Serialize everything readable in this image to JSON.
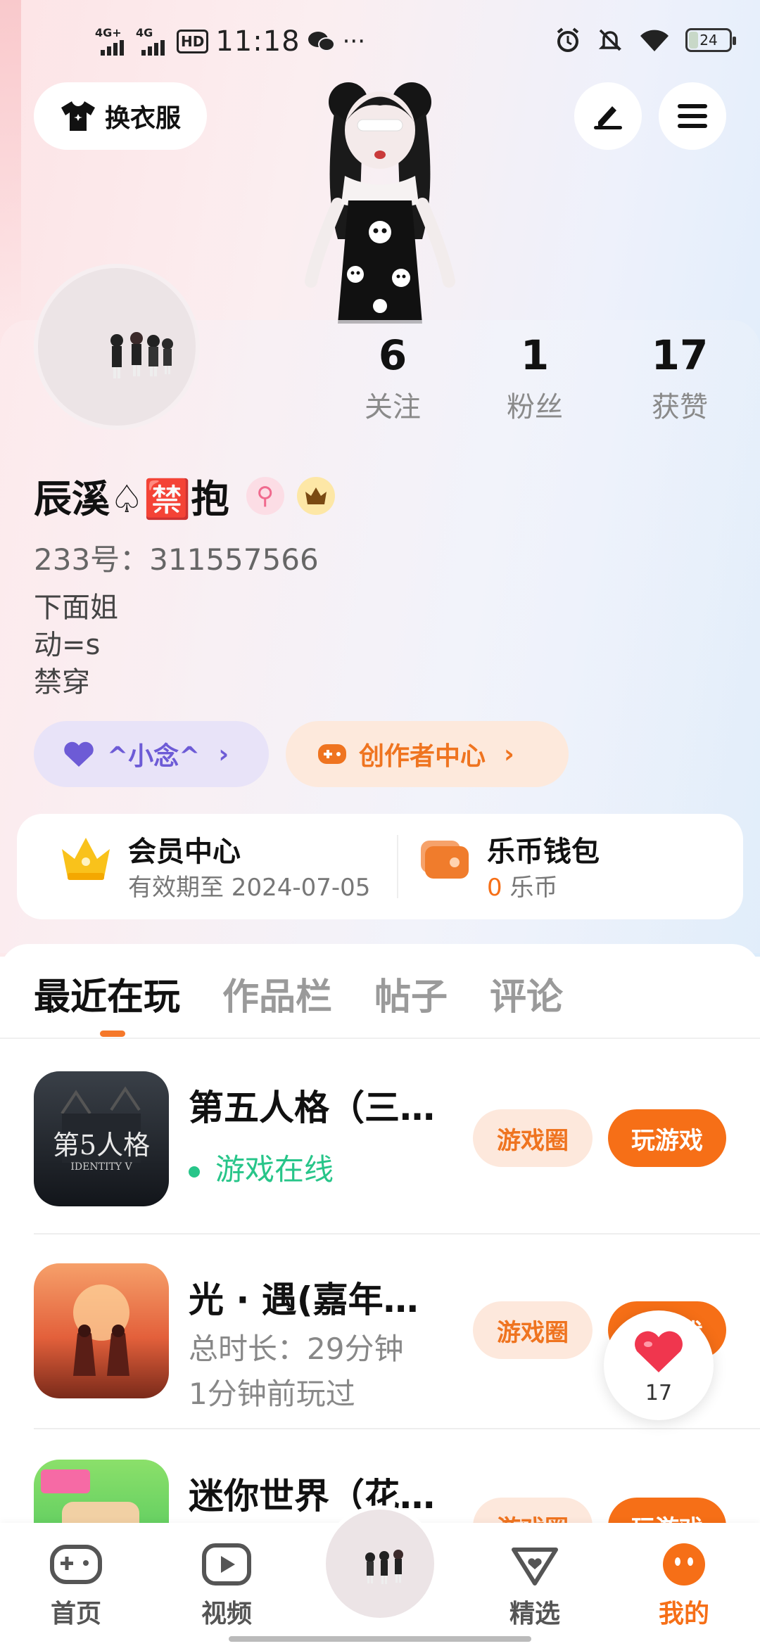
{
  "status_bar": {
    "net1": "4G+",
    "net2": "4G",
    "hd": "HD",
    "time": "11:18",
    "more": "···",
    "battery": "24"
  },
  "header": {
    "outfit_label": "换衣服"
  },
  "profile": {
    "stats": [
      {
        "value": "6",
        "label": "关注"
      },
      {
        "value": "1",
        "label": "粉丝"
      },
      {
        "value": "17",
        "label": "获赞"
      }
    ],
    "username": "辰溪♤🈲抱",
    "uid": "233号：311557566",
    "bio": [
      "下面姐",
      "动=s",
      "禁穿"
    ],
    "friend_pill": "^小念^",
    "creator_pill": "创作者中心"
  },
  "member": {
    "title": "会员中心",
    "sub": "有效期至 2024-07-05",
    "wallet_title": "乐币钱包",
    "wallet_amount": "0",
    "wallet_unit": "乐币"
  },
  "tabs": [
    "最近在玩",
    "作品栏",
    "帖子",
    "评论"
  ],
  "games": [
    {
      "name": "第五人格（三…",
      "meta1": "游戏在线",
      "circle": "游戏圈",
      "play": "玩游戏"
    },
    {
      "name": "光 · 遇(嘉年…",
      "meta1": "总时长：29分钟",
      "meta2": "1分钟前玩过",
      "circle": "游戏圈",
      "play": "玩游戏"
    },
    {
      "name": "迷你世界（花…",
      "circle": "游戏圈",
      "play": "玩游戏"
    }
  ],
  "like_count": "17",
  "bottom_nav": [
    {
      "label": "首页"
    },
    {
      "label": "视频"
    },
    {
      "label": "精选"
    },
    {
      "label": "我的"
    }
  ],
  "colors": {
    "accent": "#f66f17",
    "online": "#27c589",
    "friend": "#6d5bd6"
  }
}
